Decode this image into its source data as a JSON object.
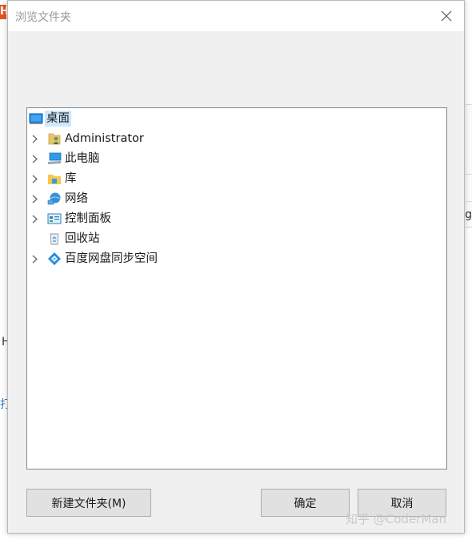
{
  "dialog": {
    "title": "浏览文件夹",
    "tree": {
      "root": {
        "label": "桌面",
        "icon": "desktop-icon"
      },
      "items": [
        {
          "label": "Administrator",
          "icon": "user-folder-icon",
          "expandable": true
        },
        {
          "label": "此电脑",
          "icon": "this-pc-icon",
          "expandable": true
        },
        {
          "label": "库",
          "icon": "library-icon",
          "expandable": true
        },
        {
          "label": "网络",
          "icon": "network-icon",
          "expandable": true
        },
        {
          "label": "控制面板",
          "icon": "control-panel-icon",
          "expandable": true
        },
        {
          "label": "回收站",
          "icon": "recycle-bin-icon",
          "expandable": false
        },
        {
          "label": "百度网盘同步空间",
          "icon": "baidu-netdisk-icon",
          "expandable": true
        }
      ]
    },
    "buttons": {
      "new_folder": "新建文件夹(M)",
      "ok": "确定",
      "cancel": "取消"
    }
  },
  "background": {
    "logo_glyph": "H",
    "frag_right_1": "g",
    "frag_left_1": "H",
    "frag_left_2": "打"
  },
  "watermark": "知乎 @CoderMan"
}
